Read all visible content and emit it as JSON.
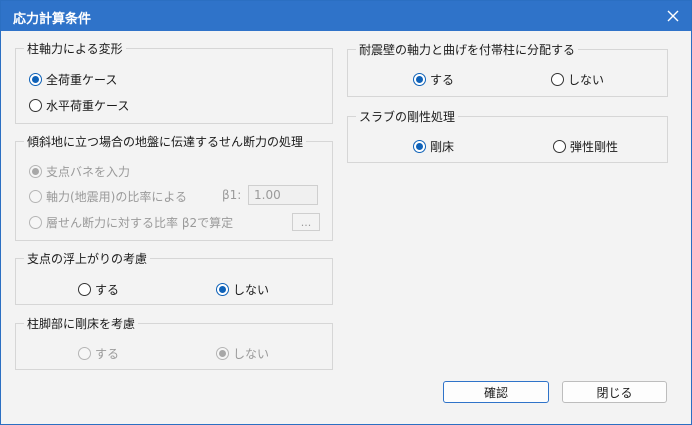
{
  "window": {
    "title": "応力計算条件"
  },
  "group_column_axial": {
    "legend": "柱軸力による変形",
    "options": [
      {
        "label": "全荷重ケース",
        "checked": true
      },
      {
        "label": "水平荷重ケース",
        "checked": false
      }
    ]
  },
  "group_slope_shear": {
    "legend": "傾斜地に立つ場合の地盤に伝達するせん断力の処理",
    "options": [
      {
        "label": "支点バネを入力",
        "checked": true
      },
      {
        "label": "軸力(地震用)の比率による",
        "checked": false
      },
      {
        "label": "層せん断力に対する比率 β2で算定",
        "checked": false
      }
    ],
    "beta1_label": "β1:",
    "beta1_value": "1.00",
    "more_button": "..."
  },
  "group_uplift": {
    "legend": "支点の浮上がりの考慮",
    "options": [
      {
        "label": "する",
        "checked": false
      },
      {
        "label": "しない",
        "checked": true
      }
    ]
  },
  "group_rigid_floor": {
    "legend": "柱脚部に剛床を考慮",
    "options": [
      {
        "label": "する",
        "checked": false
      },
      {
        "label": "しない",
        "checked": true
      }
    ]
  },
  "group_shear_wall": {
    "legend": "耐震壁の軸力と曲げを付帯柱に分配する",
    "options": [
      {
        "label": "する",
        "checked": true
      },
      {
        "label": "しない",
        "checked": false
      }
    ]
  },
  "group_slab": {
    "legend": "スラブの剛性処理",
    "options": [
      {
        "label": "剛床",
        "checked": true
      },
      {
        "label": "弾性剛性",
        "checked": false
      }
    ]
  },
  "buttons": {
    "ok": "確認",
    "close": "閉じる"
  },
  "colors": {
    "titlebar": "#2f73c9",
    "accent": "#0f62b8",
    "disabled_text": "#9a9a9a"
  }
}
